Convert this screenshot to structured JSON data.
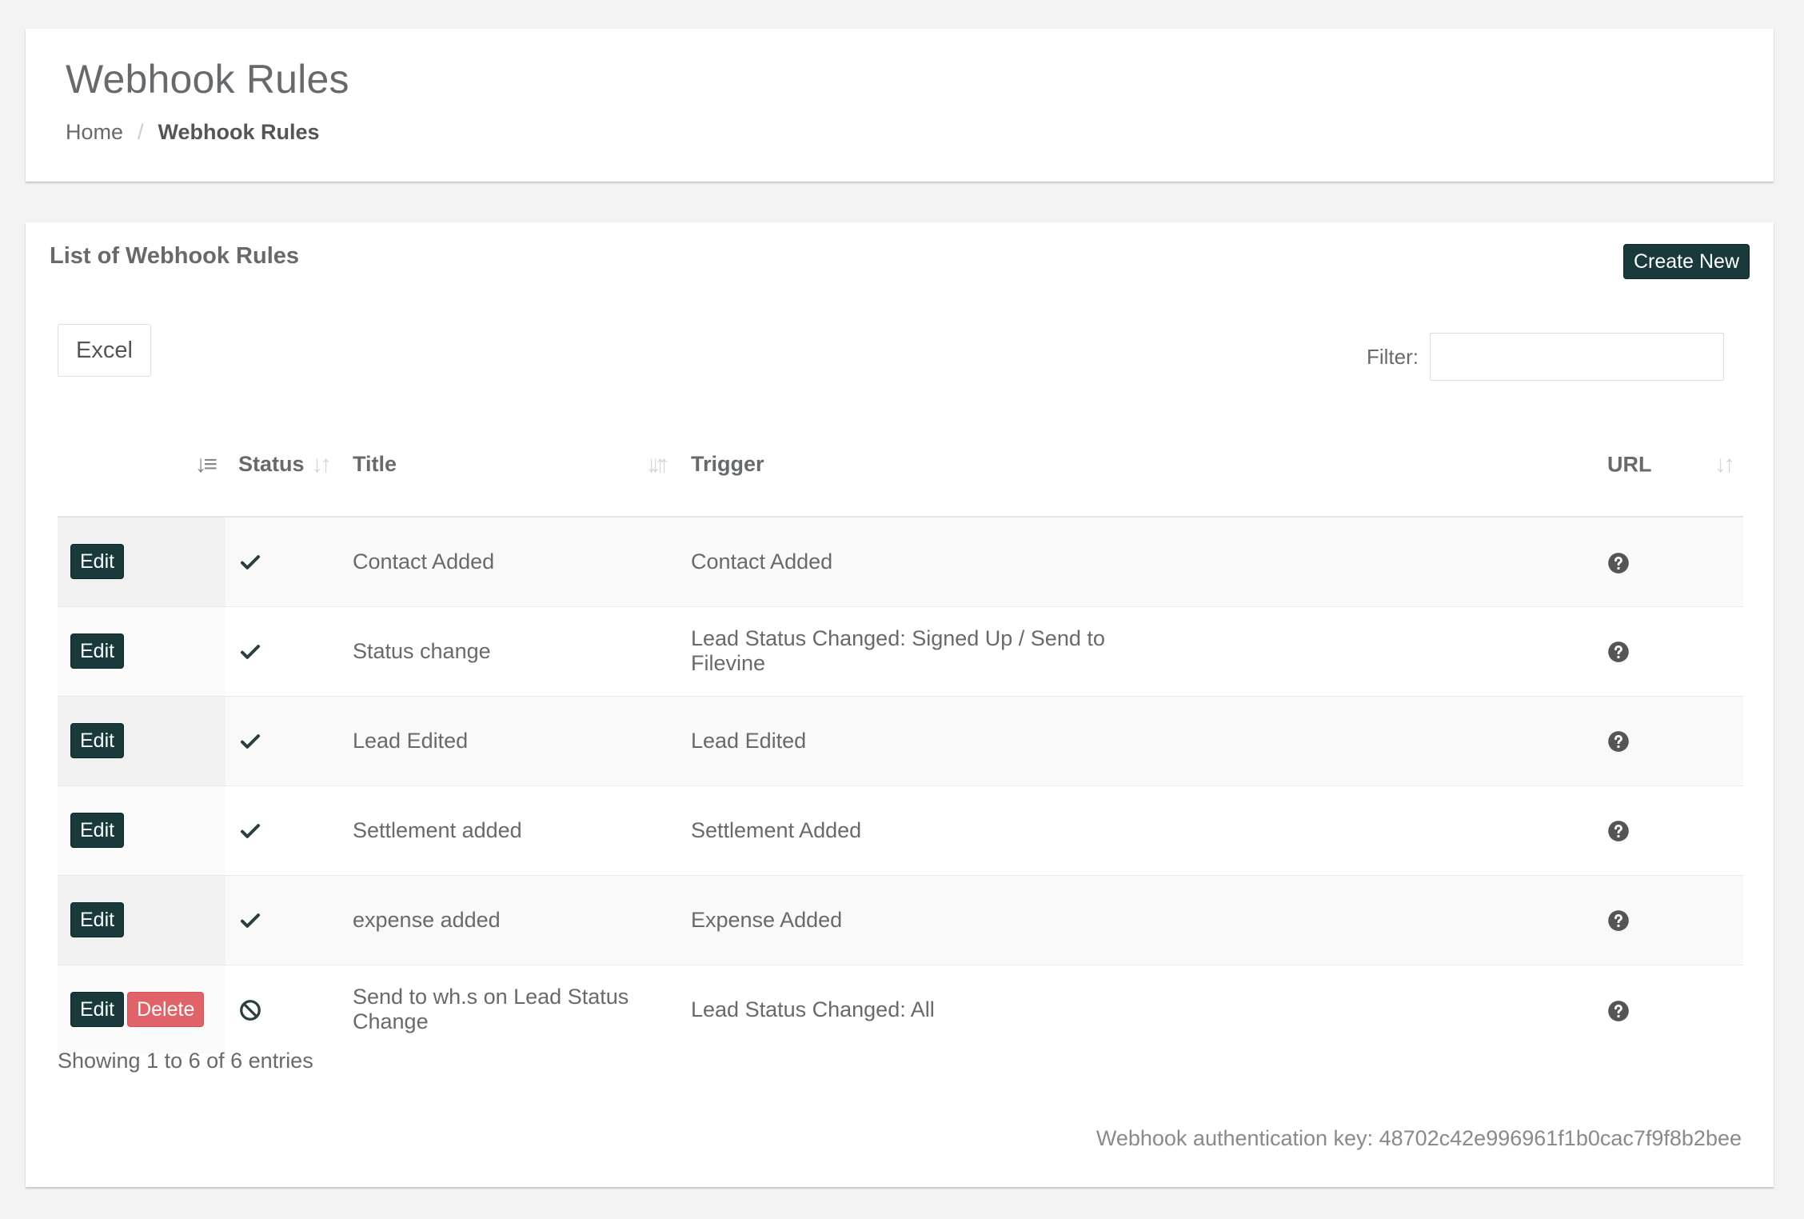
{
  "header": {
    "title": "Webhook Rules",
    "breadcrumb": {
      "home": "Home",
      "separator": "/",
      "current": "Webhook Rules"
    }
  },
  "card": {
    "title": "List of Webhook Rules",
    "create_label": "Create New",
    "excel_label": "Excel",
    "filter_label": "Filter:",
    "filter_value": ""
  },
  "table": {
    "columns": [
      "",
      "Status",
      "Title",
      "Trigger",
      "URL"
    ],
    "sorted_column": 0,
    "rows": [
      {
        "actions": [
          "Edit"
        ],
        "status": "enabled",
        "status_icon": "check-icon",
        "title": "Contact Added",
        "trigger": "Contact Added",
        "url_icon": "question-circle-icon"
      },
      {
        "actions": [
          "Edit"
        ],
        "status": "enabled",
        "status_icon": "check-icon",
        "title": "Status change",
        "trigger": "Lead Status Changed: Signed Up / Send to Filevine",
        "url_icon": "question-circle-icon"
      },
      {
        "actions": [
          "Edit"
        ],
        "status": "enabled",
        "status_icon": "check-icon",
        "title": "Lead Edited",
        "trigger": "Lead Edited",
        "url_icon": "question-circle-icon"
      },
      {
        "actions": [
          "Edit"
        ],
        "status": "enabled",
        "status_icon": "check-icon",
        "title": "Settlement added",
        "trigger": "Settlement Added",
        "url_icon": "question-circle-icon"
      },
      {
        "actions": [
          "Edit"
        ],
        "status": "enabled",
        "status_icon": "check-icon",
        "title": "expense added",
        "trigger": "Expense Added",
        "url_icon": "question-circle-icon"
      },
      {
        "actions": [
          "Edit",
          "Delete"
        ],
        "status": "disabled",
        "status_icon": "ban-icon",
        "title": "Send to wh.s on Lead Status Change",
        "trigger": "Lead Status Changed: All",
        "url_icon": "question-circle-icon"
      }
    ]
  },
  "footer": {
    "info": "Showing 1 to 6 of 6 entries",
    "auth_key": "Webhook authentication key: 48702c42e996961f1b0cac7f9f8b2bee"
  },
  "colors": {
    "primary_button": "#19393a",
    "danger_button": "#e0636a",
    "text": "#676a6c",
    "background": "#f3f3f3"
  }
}
